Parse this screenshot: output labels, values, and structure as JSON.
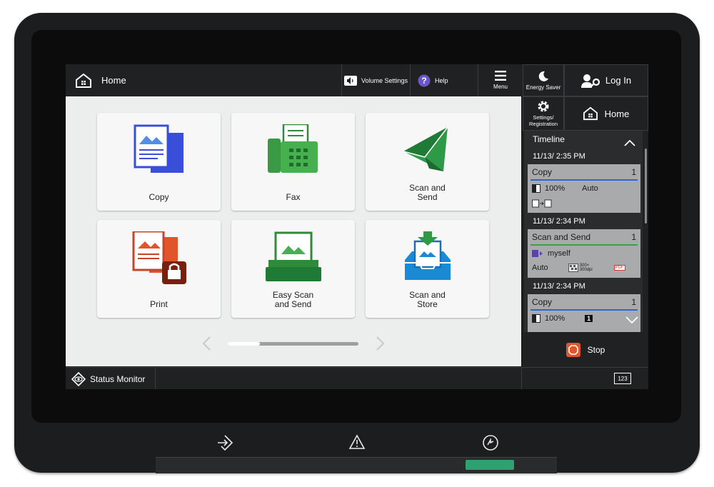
{
  "topbar": {
    "home_label": "Home",
    "volume_label": "Volume Settings",
    "help_label": "Help",
    "menu_label": "Menu",
    "energy_label": "Energy Saver",
    "login_label": "Log In",
    "settings_label_1": "Settings/",
    "settings_label_2": "Registration",
    "home2_label": "Home"
  },
  "tiles": [
    {
      "label": "Copy",
      "icon": "copy-icon"
    },
    {
      "label": "Fax",
      "icon": "fax-icon"
    },
    {
      "label": "Scan and\nSend",
      "icon": "scan-send-icon"
    },
    {
      "label": "Print",
      "icon": "print-icon"
    },
    {
      "label": "Easy Scan\nand Send",
      "icon": "easy-scan-icon"
    },
    {
      "label": "Scan and\nStore",
      "icon": "scan-store-icon"
    }
  ],
  "pager": {
    "current_page": 1,
    "total_pages": 2
  },
  "timeline": {
    "title": "Timeline",
    "jobs": [
      {
        "date": "11/13/ 2:35 PM",
        "name": "Copy",
        "count": "1",
        "color": "#2f63d8",
        "detail1": "100%",
        "detail2": "Auto"
      },
      {
        "date": "11/13/ 2:34 PM",
        "name": "Scan and Send",
        "count": "1",
        "color": "#3aa04a",
        "dest": "myself",
        "detail1": "Auto",
        "res_line1": "300×",
        "res_line2": "300dpi",
        "format": "PDF"
      },
      {
        "date": "11/13/ 2:34 PM",
        "name": "Copy",
        "count": "1",
        "color": "#2f63d8",
        "detail1": "100%",
        "badge": "1"
      }
    ]
  },
  "stop": {
    "label": "Stop"
  },
  "statusbar": {
    "status_label": "Status Monitor",
    "keypad_label": "123"
  },
  "colors": {
    "accent_blue": "#2f63d8",
    "accent_green": "#3aa04a",
    "stop_orange": "#e2552a",
    "power_led": "#2fa06f"
  }
}
